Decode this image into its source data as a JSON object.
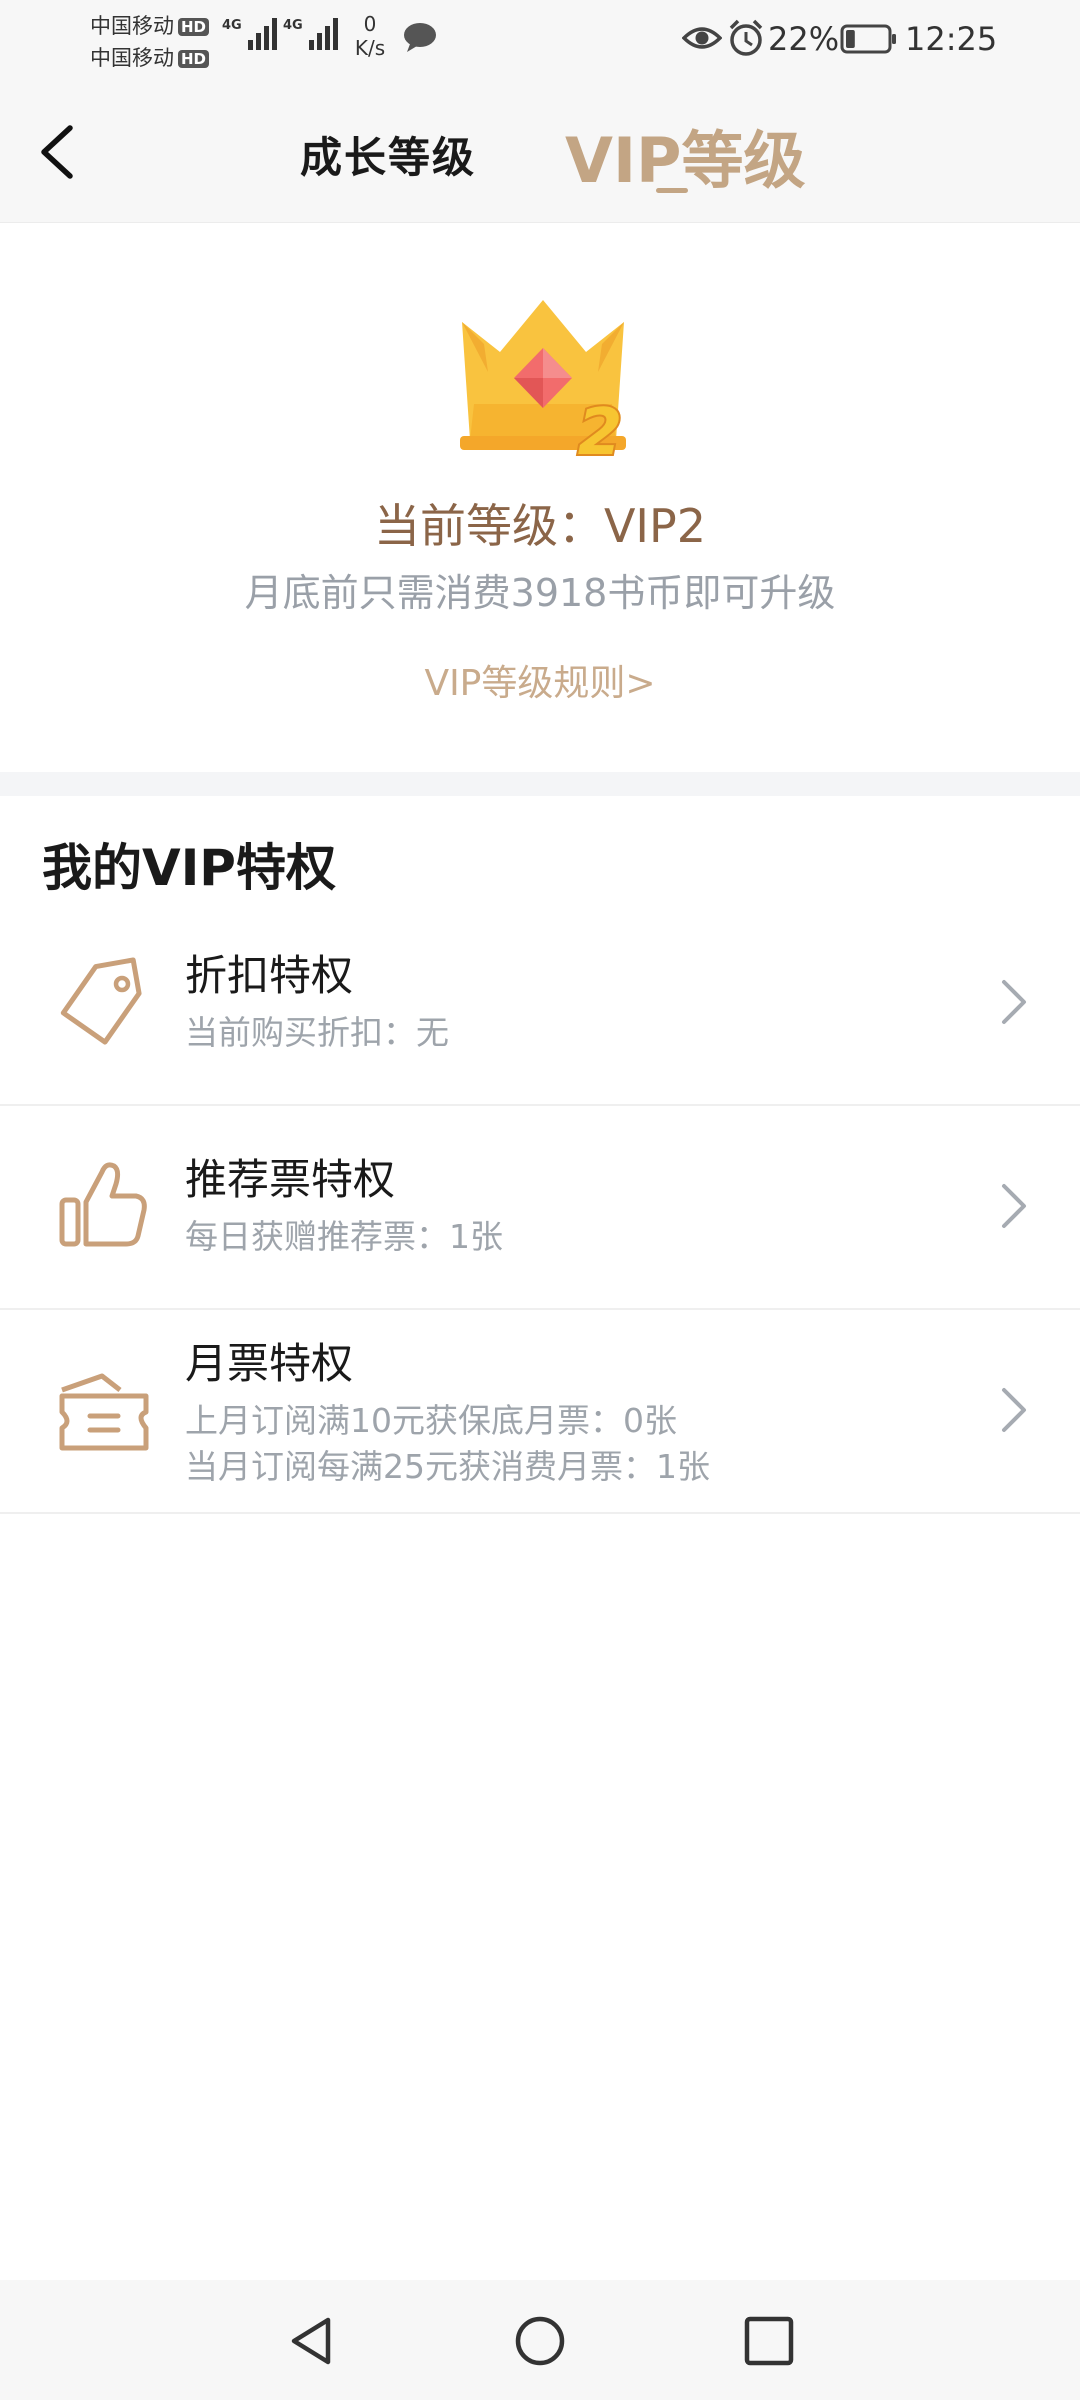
{
  "status_bar": {
    "carrier_1": "中国移动",
    "carrier_2": "中国移动",
    "hd_badge": "HD",
    "network_type": "4G",
    "net_speed_value": "0",
    "net_speed_unit": "K/s",
    "battery_percent": "22%",
    "battery_level": 0.22,
    "time": "12:25"
  },
  "header": {
    "tab_growth": "成长等级",
    "tab_vip": "VIP等级",
    "active_tab": "tab_vip",
    "accent_color": "#c3a584"
  },
  "level": {
    "badge_number": "2",
    "current_level": "当前等级：VIP2",
    "upgrade_tip": "月底前只需消费3918书币即可升级",
    "rules_link": "VIP等级规则>"
  },
  "privileges": {
    "section_title": "我的VIP特权",
    "items": [
      {
        "icon": "price-tag-icon",
        "title": "折扣特权",
        "desc": "当前购买折扣：无"
      },
      {
        "icon": "thumbs-up-icon",
        "title": "推荐票特权",
        "desc": "每日获赠推荐票：1张"
      },
      {
        "icon": "ticket-icon",
        "title": "月票特权",
        "desc": "上月订阅满10元获保底月票：0张",
        "desc2": "当月订阅每满25元获消费月票：1张"
      }
    ]
  },
  "nav_bar": {
    "buttons": [
      "back-triangle-icon",
      "home-circle-icon",
      "recents-square-icon"
    ]
  }
}
